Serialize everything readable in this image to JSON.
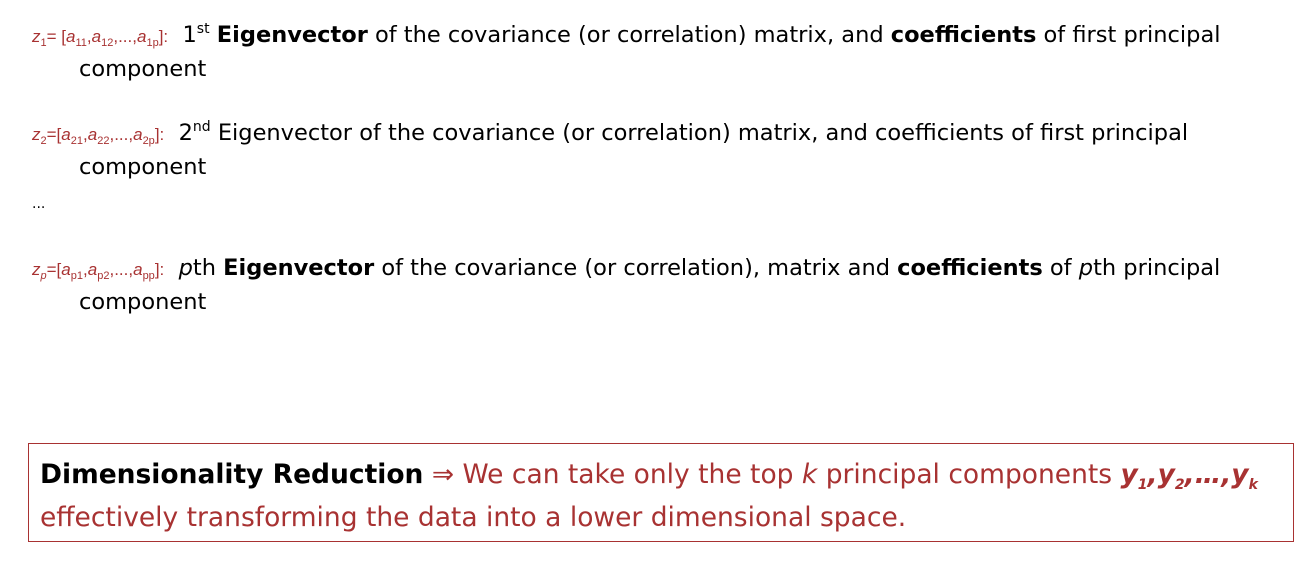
{
  "entries": [
    {
      "eq_var": "z",
      "eq_var_sub": "1",
      "eq_rhs": "= [a11,a12,...,a1p]:",
      "eq_open": "= [",
      "eq_terms": [
        {
          "base": "a",
          "sub": "11"
        },
        {
          "base": "a",
          "sub": "12"
        },
        {
          "base": "...",
          "sub": ""
        },
        {
          "base": "a",
          "sub": "1p"
        }
      ],
      "ordinal_num": "1",
      "ordinal_suffix": "st",
      "eigenvector": "Eigenvector",
      "mid_text": " of  the covariance (or correlation)     matrix, and ",
      "coefficients": "coefficients",
      "tail_text": " of first principal",
      "line2": "component"
    },
    {
      "eq_var": "z",
      "eq_var_sub": "2",
      "eq_open": "=[",
      "eq_terms": [
        {
          "base": "a",
          "sub": "21"
        },
        {
          "base": "a",
          "sub": "22"
        },
        {
          "base": "...",
          "sub": ""
        },
        {
          "base": "a",
          "sub": "2p"
        }
      ],
      "ordinal_num": "2",
      "ordinal_suffix": "nd",
      "eigenvector": "Eigenvector",
      "mid_text": " of  the covariance (or correlation)     matrix, and coefficients of first principal",
      "line2": "component"
    },
    {
      "eq_var": "z",
      "eq_var_sub": "p",
      "eq_open": "=[",
      "eq_terms": [
        {
          "base": "a",
          "sub": "p1"
        },
        {
          "base": "a",
          "sub": "p2"
        },
        {
          "base": "...",
          "sub": ""
        },
        {
          "base": "a",
          "sub": "pp"
        }
      ],
      "ordinal_italic": "p",
      "ordinal_rest": "th",
      "eigenvector": "Eigenvector",
      "mid_text": " of the covariance (or correlation), matrix and ",
      "coefficients": "coefficients",
      "tail_pre": " of ",
      "tail_italic": "p",
      "tail_post": "th principal",
      "line2": "component"
    }
  ],
  "ellipsis": "...",
  "callout": {
    "term": "Dimensionality Reduction",
    "arrow_glyph": "⇒",
    "text_before_k": " We can take only the top ",
    "k": "k",
    "text_after_k": " principal components ",
    "y_terms": [
      {
        "base": "y",
        "sub": "1"
      },
      {
        "base": "y",
        "sub": "2"
      },
      {
        "base": "…",
        "sub": ""
      },
      {
        "base": "y",
        "sub": "k"
      }
    ],
    "line2": "effectively transforming the data into a lower dimensional space."
  },
  "colors": {
    "accent": "#a83232",
    "text": "#000000"
  }
}
